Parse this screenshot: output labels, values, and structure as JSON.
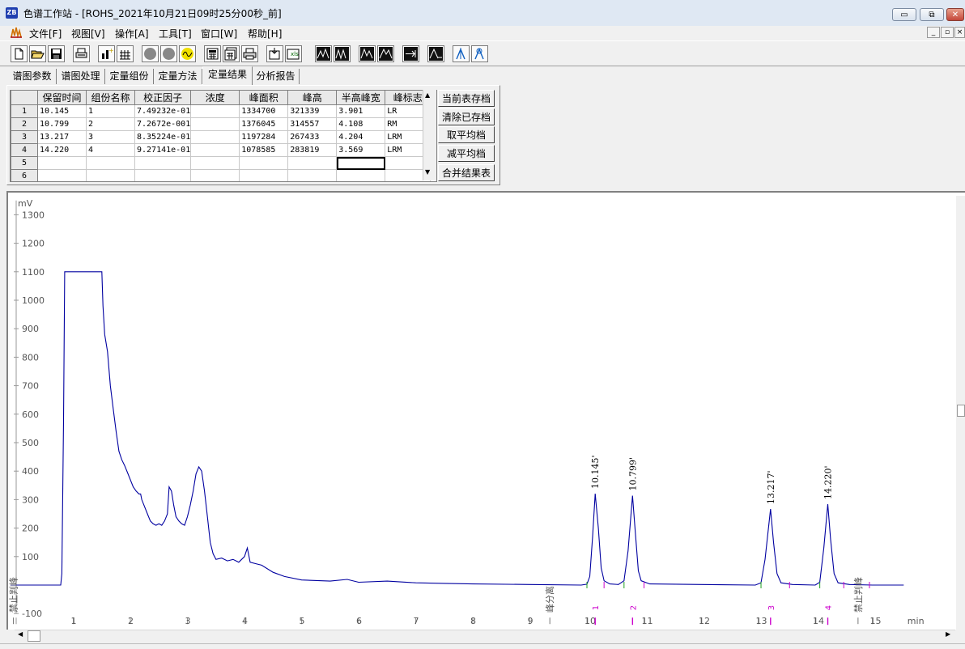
{
  "window": {
    "title": "色谱工作站 - [ROHS_2021年10月21日09时25分00秒_前]",
    "icon_label": "ZB"
  },
  "window_controls": {
    "minimize": "▭",
    "restore": "⧉",
    "close": "✕"
  },
  "mdi_controls": {
    "minimize": "_",
    "restore": "▫",
    "close": "×"
  },
  "menu": {
    "logo_icon": "chart-logo-icon",
    "items": [
      {
        "label": "文件[F]"
      },
      {
        "label": "视图[V]"
      },
      {
        "label": "操作[A]"
      },
      {
        "label": "工具[T]"
      },
      {
        "label": "窗口[W]"
      },
      {
        "label": "帮助[H]"
      }
    ]
  },
  "toolbar": {
    "buttons": [
      {
        "name": "new-file-icon"
      },
      {
        "name": "open-folder-icon"
      },
      {
        "name": "save-icon"
      },
      {
        "name": "print-setup-icon"
      },
      {
        "name": "bar-add-icon"
      },
      {
        "name": "table-calc-icon"
      },
      {
        "name": "gray-circle-icon"
      },
      {
        "name": "gray-circle-icon"
      },
      {
        "name": "yellow-wave-icon"
      },
      {
        "name": "calculator-icon"
      },
      {
        "name": "calculator-alt-icon"
      },
      {
        "name": "printer-icon"
      },
      {
        "name": "export-icon"
      },
      {
        "name": "excel-export-icon"
      },
      {
        "name": "peak-icon"
      },
      {
        "name": "peak-dual-icon"
      },
      {
        "name": "peak-split-icon"
      },
      {
        "name": "peak-merge-icon"
      },
      {
        "name": "arrow-right-icon"
      },
      {
        "name": "peak-baseline-icon"
      },
      {
        "name": "peak-marker-icon"
      },
      {
        "name": "peak-marker-alt-icon"
      }
    ]
  },
  "tabs": [
    {
      "label": "谱图参数"
    },
    {
      "label": "谱图处理"
    },
    {
      "label": "定量组份"
    },
    {
      "label": "定量方法"
    },
    {
      "label": "定量结果",
      "active": true
    },
    {
      "label": "分析报告"
    }
  ],
  "results_table": {
    "headers": [
      "保留时间",
      "组份名称",
      "校正因子",
      "浓度",
      "峰面积",
      "峰高",
      "半高峰宽",
      "峰标志"
    ],
    "rows": [
      {
        "num": "1",
        "cells": [
          "10.145",
          "1",
          "7.49232e-01",
          "",
          "1334700",
          "321339",
          "3.901",
          "LR"
        ]
      },
      {
        "num": "2",
        "cells": [
          "10.799",
          "2",
          "7.2672e-001",
          "",
          "1376045",
          "314557",
          "4.108",
          "RM"
        ]
      },
      {
        "num": "3",
        "cells": [
          "13.217",
          "3",
          "8.35224e-01",
          "",
          "1197284",
          "267433",
          "4.204",
          "LRM"
        ]
      },
      {
        "num": "4",
        "cells": [
          "14.220",
          "4",
          "9.27141e-01",
          "",
          "1078585",
          "283819",
          "3.569",
          "LRM"
        ]
      },
      {
        "num": "5",
        "cells": [
          "",
          "",
          "",
          "",
          "",
          "",
          "",
          ""
        ]
      },
      {
        "num": "6",
        "cells": [
          "",
          "",
          "",
          "",
          "",
          "",
          "",
          ""
        ]
      }
    ],
    "selected_cell": {
      "row": 5,
      "col": 7
    }
  },
  "side_buttons": [
    {
      "label": "当前表存档"
    },
    {
      "label": "清除已存档"
    },
    {
      "label": "取平均档"
    },
    {
      "label": "减平均档"
    },
    {
      "label": "合并结果表"
    }
  ],
  "chart_data": {
    "type": "line",
    "title": "",
    "ylabel": "mV",
    "xlabel": "min",
    "xlim": [
      -0.1,
      15.6
    ],
    "ylim": [
      -100,
      1350
    ],
    "y_ticks": [
      -100,
      100,
      200,
      300,
      400,
      500,
      600,
      700,
      800,
      900,
      1000,
      1100,
      1200,
      1300
    ],
    "x_ticks": [
      1,
      2,
      3,
      4,
      5,
      6,
      7,
      8,
      9,
      10,
      11,
      12,
      13,
      14,
      15
    ],
    "series": [
      {
        "color": "#0000a0",
        "points": [
          [
            -0.1,
            0
          ],
          [
            0.78,
            0
          ],
          [
            0.8,
            40
          ],
          [
            0.83,
            580
          ],
          [
            0.85,
            1100
          ],
          [
            1.5,
            1100
          ],
          [
            1.52,
            980
          ],
          [
            1.55,
            880
          ],
          [
            1.6,
            820
          ],
          [
            1.65,
            700
          ],
          [
            1.7,
            620
          ],
          [
            1.75,
            540
          ],
          [
            1.8,
            470
          ],
          [
            1.85,
            440
          ],
          [
            1.9,
            420
          ],
          [
            1.95,
            395
          ],
          [
            2.0,
            370
          ],
          [
            2.05,
            345
          ],
          [
            2.1,
            330
          ],
          [
            2.15,
            320
          ],
          [
            2.18,
            320
          ],
          [
            2.2,
            300
          ],
          [
            2.25,
            275
          ],
          [
            2.3,
            250
          ],
          [
            2.35,
            225
          ],
          [
            2.4,
            215
          ],
          [
            2.45,
            210
          ],
          [
            2.5,
            215
          ],
          [
            2.55,
            210
          ],
          [
            2.6,
            225
          ],
          [
            2.65,
            250
          ],
          [
            2.68,
            345
          ],
          [
            2.72,
            330
          ],
          [
            2.76,
            280
          ],
          [
            2.8,
            240
          ],
          [
            2.85,
            225
          ],
          [
            2.9,
            215
          ],
          [
            2.95,
            210
          ],
          [
            3.0,
            240
          ],
          [
            3.05,
            280
          ],
          [
            3.1,
            330
          ],
          [
            3.15,
            390
          ],
          [
            3.2,
            415
          ],
          [
            3.25,
            400
          ],
          [
            3.3,
            330
          ],
          [
            3.35,
            240
          ],
          [
            3.4,
            150
          ],
          [
            3.45,
            110
          ],
          [
            3.5,
            90
          ],
          [
            3.6,
            95
          ],
          [
            3.7,
            85
          ],
          [
            3.8,
            90
          ],
          [
            3.9,
            80
          ],
          [
            4.0,
            100
          ],
          [
            4.05,
            130
          ],
          [
            4.1,
            80
          ],
          [
            4.2,
            75
          ],
          [
            4.3,
            70
          ],
          [
            4.5,
            45
          ],
          [
            4.7,
            30
          ],
          [
            5.0,
            18
          ],
          [
            5.5,
            14
          ],
          [
            5.8,
            20
          ],
          [
            6.0,
            10
          ],
          [
            6.5,
            14
          ],
          [
            7.0,
            8
          ],
          [
            7.5,
            6
          ],
          [
            8.0,
            4
          ],
          [
            9.0,
            2
          ],
          [
            9.9,
            0
          ],
          [
            10.0,
            3
          ],
          [
            10.05,
            30
          ],
          [
            10.1,
            170
          ],
          [
            10.145,
            321
          ],
          [
            10.2,
            200
          ],
          [
            10.25,
            60
          ],
          [
            10.3,
            15
          ],
          [
            10.4,
            4
          ],
          [
            10.55,
            2
          ],
          [
            10.65,
            15
          ],
          [
            10.72,
            120
          ],
          [
            10.799,
            314
          ],
          [
            10.85,
            180
          ],
          [
            10.9,
            50
          ],
          [
            10.95,
            15
          ],
          [
            11.1,
            4
          ],
          [
            12.0,
            2
          ],
          [
            12.95,
            0
          ],
          [
            13.05,
            8
          ],
          [
            13.12,
            90
          ],
          [
            13.217,
            267
          ],
          [
            13.27,
            150
          ],
          [
            13.33,
            40
          ],
          [
            13.4,
            8
          ],
          [
            13.6,
            2
          ],
          [
            14.0,
            0
          ],
          [
            14.08,
            10
          ],
          [
            14.15,
            130
          ],
          [
            14.22,
            284
          ],
          [
            14.27,
            160
          ],
          [
            14.33,
            40
          ],
          [
            14.4,
            8
          ],
          [
            14.6,
            2
          ],
          [
            15.0,
            0
          ],
          [
            15.55,
            0
          ]
        ]
      }
    ],
    "peak_labels": [
      {
        "x": 10.145,
        "y": 321,
        "text": "10.145'",
        "marker": "1"
      },
      {
        "x": 10.799,
        "y": 314,
        "text": "10.799'",
        "marker": "2"
      },
      {
        "x": 13.217,
        "y": 267,
        "text": "13.217'",
        "marker": "3"
      },
      {
        "x": 14.22,
        "y": 284,
        "text": "14.220'",
        "marker": "4"
      }
    ],
    "event_labels": [
      {
        "x": -0.05,
        "text": "禁止判峰"
      },
      {
        "x": 9.35,
        "text": "峰分离"
      },
      {
        "x": 14.75,
        "text": "禁止判峰"
      }
    ],
    "baseline_marks": [
      {
        "x": 10.0,
        "color": "#20a020"
      },
      {
        "x": 10.3,
        "color": "#cc00cc"
      },
      {
        "x": 10.65,
        "color": "#20a020"
      },
      {
        "x": 11.0,
        "color": "#cc00cc"
      },
      {
        "x": 13.05,
        "color": "#20a020"
      },
      {
        "x": 13.55,
        "color": "#cc00cc"
      },
      {
        "x": 14.08,
        "color": "#20a020"
      },
      {
        "x": 14.5,
        "color": "#cc00cc"
      },
      {
        "x": 14.95,
        "color": "#cc00cc"
      }
    ]
  }
}
